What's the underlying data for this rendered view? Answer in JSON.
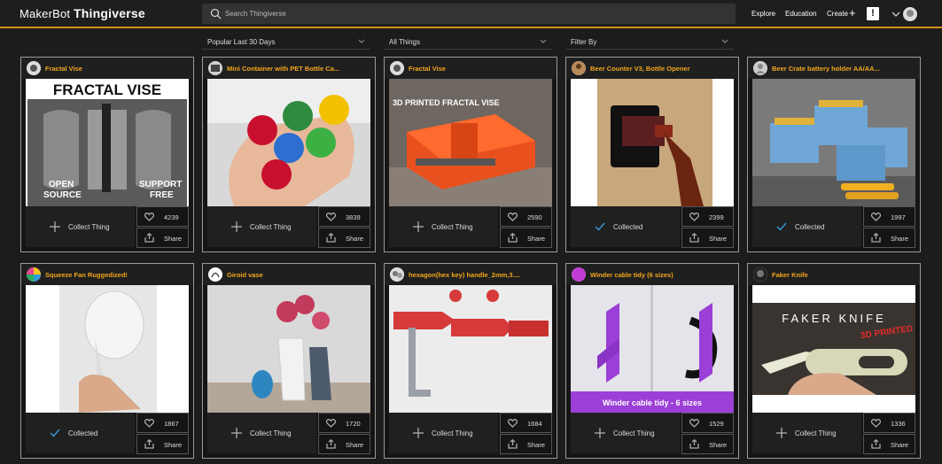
{
  "header": {
    "logo_brand": "MakerBot",
    "logo_product": "Thingiverse",
    "search_placeholder": "Search Thingiverse",
    "nav": {
      "explore": "Explore",
      "education": "Education",
      "create": "Create"
    },
    "alert_label": "!"
  },
  "filters": [
    {
      "label": "Popular Last 30 Days"
    },
    {
      "label": "All Things"
    },
    {
      "label": "Filter By"
    }
  ],
  "cards": [
    {
      "title": "Fractal Vise",
      "likes": "4239",
      "collected": false,
      "action_label": "Collect Thing",
      "share_label": "Share",
      "image_text": [
        "FRACTAL VISE",
        "OPEN",
        "SOURCE",
        "SUPPORT",
        "FREE"
      ]
    },
    {
      "title": "Mini Container with PET Bottle Ca...",
      "likes": "3839",
      "collected": false,
      "action_label": "Collect Thing",
      "share_label": "Share",
      "image_text": []
    },
    {
      "title": "Fractal Vise",
      "likes": "2590",
      "collected": false,
      "action_label": "Collect Thing",
      "share_label": "Share",
      "image_text": [
        "3D PRINTED FRACTAL VISE"
      ]
    },
    {
      "title": "Beer Counter V3, Bottle Opener",
      "likes": "2399",
      "collected": true,
      "action_label": "Collected",
      "share_label": "Share",
      "image_text": []
    },
    {
      "title": "Beer Crate battery holder AA/AA...",
      "likes": "1997",
      "collected": true,
      "action_label": "Collected",
      "share_label": "Share",
      "image_text": []
    },
    {
      "title": "Squeeze Fan Ruggedized!",
      "likes": "1867",
      "collected": true,
      "action_label": "Collected",
      "share_label": "Share",
      "image_text": []
    },
    {
      "title": "Giroid vase",
      "likes": "1720",
      "collected": false,
      "action_label": "Collect Thing",
      "share_label": "Share",
      "image_text": []
    },
    {
      "title": "hexagon(hex key) handle_2mm,3....",
      "likes": "1684",
      "collected": false,
      "action_label": "Collect Thing",
      "share_label": "Share",
      "image_text": []
    },
    {
      "title": "Winder cable tidy (6 sizes)",
      "likes": "1529",
      "collected": false,
      "action_label": "Collect Thing",
      "share_label": "Share",
      "image_text": [
        "Winder cable tidy - 6 sizes"
      ]
    },
    {
      "title": "Faker Knife",
      "likes": "1336",
      "collected": false,
      "action_label": "Collect Thing",
      "share_label": "Share",
      "image_text": [
        "FAKER KNIFE",
        "3D PRINTED"
      ]
    }
  ],
  "colors": {
    "accent": "#d48f1a",
    "title": "#f2a71b",
    "collected_check": "#3b9bdc",
    "background": "#1c1c1c"
  }
}
